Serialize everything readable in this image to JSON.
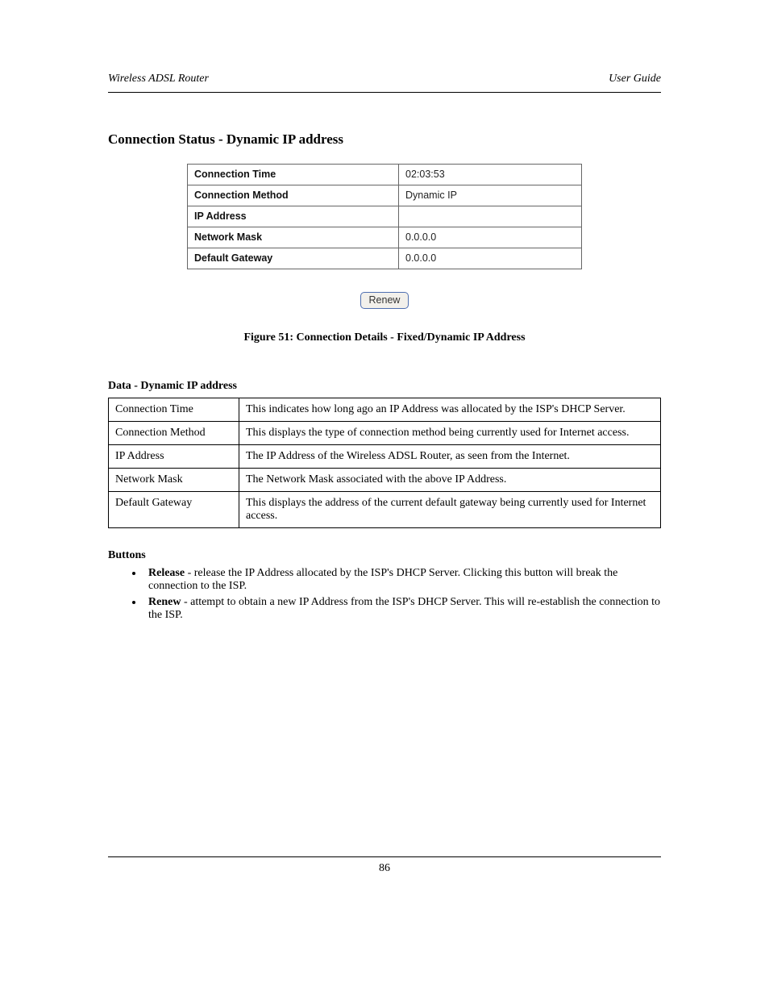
{
  "header": {
    "left": "Wireless ADSL Router",
    "right": "User Guide"
  },
  "section_heading": "Connection Status - Dynamic IP address",
  "status_table": [
    {
      "label": "Connection Time",
      "value": "02:03:53"
    },
    {
      "label": "Connection Method",
      "value": "Dynamic IP"
    },
    {
      "label": "IP Address",
      "value": ""
    },
    {
      "label": "Network Mask",
      "value": "0.0.0.0"
    },
    {
      "label": "Default Gateway",
      "value": "0.0.0.0"
    }
  ],
  "renew_label": "Renew",
  "figure_caption": "Figure 51: Connection Details - Fixed/Dynamic IP Address",
  "data_heading": "Data - Dynamic IP address",
  "data_table": [
    {
      "label": "Connection Time",
      "value": "This indicates how long ago an IP Address was allocated by the ISP's DHCP Server."
    },
    {
      "label": "Connection Method",
      "value": "This displays the type of connection method being currently used for Internet access."
    },
    {
      "label": "IP Address",
      "value": "The IP Address of the Wireless ADSL Router, as seen from the Internet."
    },
    {
      "label": "Network Mask",
      "value": "The Network Mask associated with the above IP Address."
    },
    {
      "label": "Default Gateway",
      "value": "This displays the address of the current default gateway being currently used for Internet access."
    }
  ],
  "buttons_heading": "Buttons",
  "buttons": [
    {
      "label": "Release",
      "desc": " - release the IP Address allocated by the ISP's DHCP Server. Clicking this button will break the connection to the ISP."
    },
    {
      "label": "Renew",
      "desc": " - attempt to obtain a new IP Address from the ISP's DHCP Server. This will re-establish the connection to the ISP."
    }
  ],
  "footer": "86"
}
